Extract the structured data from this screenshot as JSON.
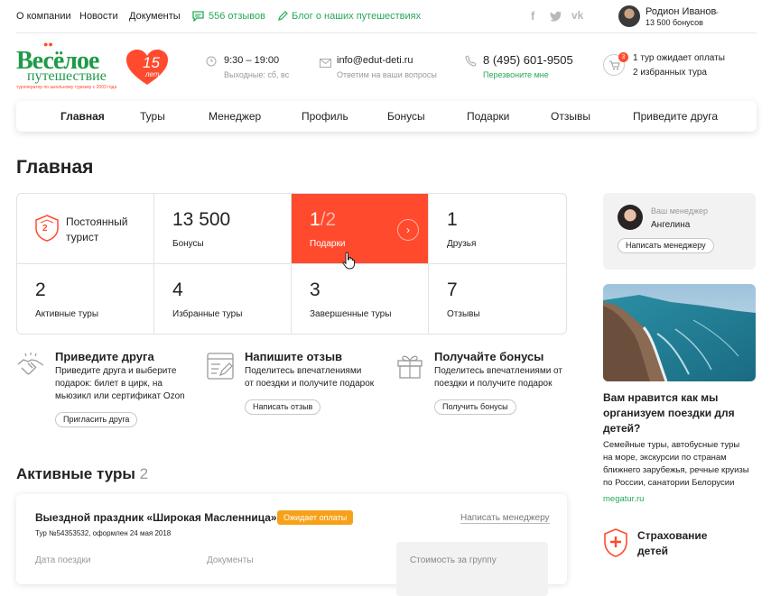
{
  "topbar": {
    "links": [
      "О компании",
      "Новости",
      "Документы"
    ],
    "reviews": "556 отзывов",
    "blog": "Блог о наших путешествиях",
    "user_name": "Родион Иванов",
    "user_bonus": "13 500 бонусов"
  },
  "header": {
    "logo_line1": "Весёлое",
    "logo_line2": "путешествие",
    "logo_tagline": "туроператор по школьному туризму с 2003 года",
    "logo_years": "15",
    "logo_years_sub": "лет",
    "hours": "9:30 – 19:00",
    "hours_sub": "Выходные: сб, вс",
    "email": "info@edut-deti.ru",
    "email_sub": "Ответим на ваши вопросы",
    "phone": "8 (495) 601-9505",
    "phone_sub": "Перезвоните мне",
    "cart_badge": "3",
    "cart_line1": "1 тур ожидает оплаты",
    "cart_line2": "2 избранных тура"
  },
  "nav": [
    "Главная",
    "Туры",
    "Менеджер",
    "Профиль",
    "Бонусы",
    "Подарки",
    "Отзывы",
    "Приведите друга"
  ],
  "page_title": "Главная",
  "status": {
    "label_line1": "Постоянный",
    "label_line2": "турист",
    "badge": "2"
  },
  "stats": {
    "bonus_num": "13 500",
    "bonus_lbl": "Бонусы",
    "gifts_num": "1",
    "gifts_total": "/2",
    "gifts_lbl": "Подарки",
    "friends_num": "1",
    "friends_lbl": "Друзья",
    "active_num": "2",
    "active_lbl": "Активные туры",
    "fav_num": "4",
    "fav_lbl": "Избранные туры",
    "done_num": "3",
    "done_lbl": "Завершенные туры",
    "reviews_num": "7",
    "reviews_lbl": "Отзывы"
  },
  "promos": [
    {
      "title": "Приведите друга",
      "desc1": "Приведите друга и выберите",
      "desc2": "подарок: билет в цирк, на",
      "desc3": "мьюзикл или сертификат Ozon",
      "btn": "Пригласить друга"
    },
    {
      "title": "Напишите отзыв",
      "desc1": "Поделитесь впечатлениями",
      "desc2": "от поездки и получите подарок",
      "desc3": "",
      "btn": "Написать отзыв"
    },
    {
      "title": "Получайте бонусы",
      "desc1": "Поделитесь впечатлениями от",
      "desc2": "поездки и получите подарок",
      "desc3": "",
      "btn": "Получить бонусы"
    }
  ],
  "active": {
    "title": "Активные туры",
    "count": "2"
  },
  "tour": {
    "name": "Выездной праздник «Широкая Масленница»",
    "status": "Ожидает оплаты",
    "meta": "Тур №54353532, оформлен 24 мая 2018",
    "write_mgr": "Написать менеджеру",
    "col_date": "Дата поездки",
    "col_docs": "Документы",
    "cost_lbl": "Стоимость за группу"
  },
  "manager": {
    "label": "Ваш менеджер",
    "name": "Ангелина",
    "btn": "Написать менеджеру"
  },
  "ad": {
    "title1": "Вам нравится как мы",
    "title2": "организуем поездки для",
    "title3": "детей?",
    "text1": "Семейные туры, автобусные туры",
    "text2": "на море, экскурсии по странам",
    "text3": "ближнего зарубежья, речные круизы",
    "text4": "по России, санатории Белорусии",
    "link": "megatur.ru"
  },
  "insurance": {
    "line1": "Страхование",
    "line2": "детей"
  },
  "colors": {
    "accent_red": "#ff4a2e",
    "green": "#27a85a",
    "logo_green": "#1e9a48"
  }
}
